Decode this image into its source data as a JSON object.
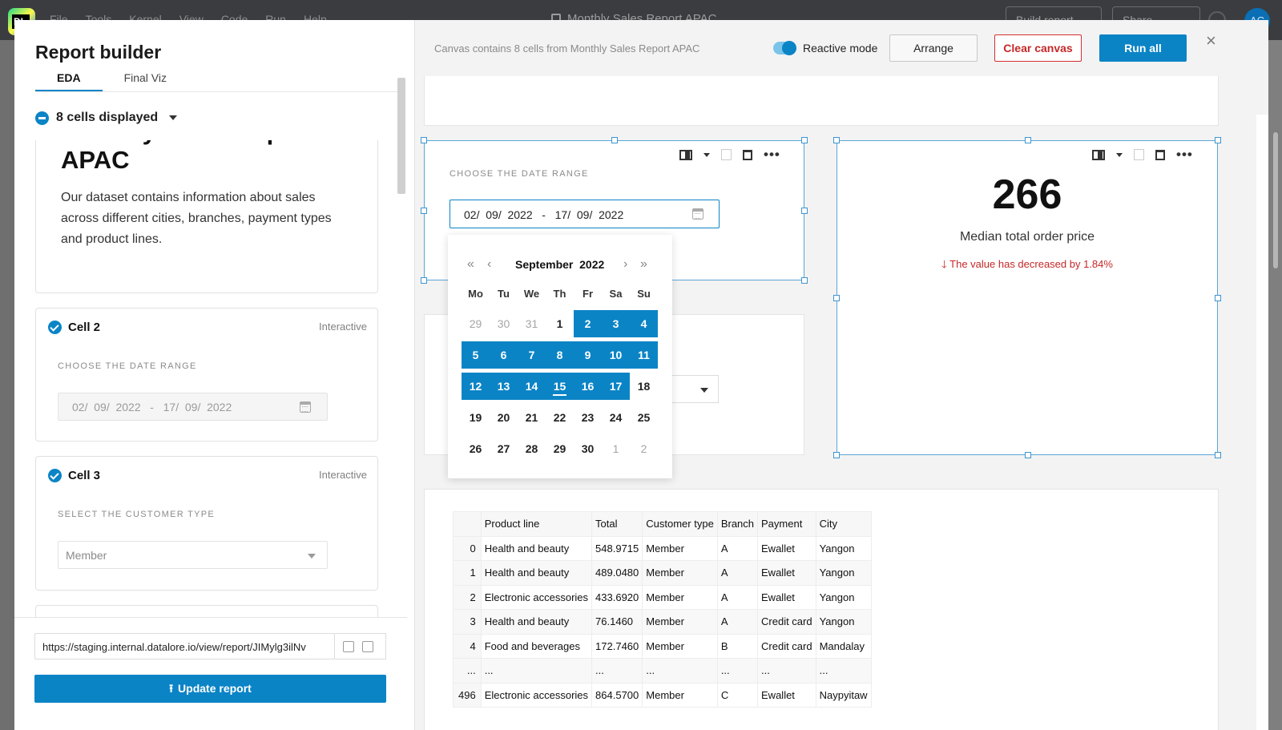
{
  "app": {
    "menu": [
      "File",
      "Tools",
      "Kernel",
      "View",
      "Code",
      "Run",
      "Help"
    ],
    "doc_title": "Monthly Sales Report APAC",
    "build_report": "Build report",
    "share": "Share",
    "avatar": "AC",
    "logo_text": "DL"
  },
  "panel": {
    "title": "Report builder",
    "tabs": [
      "EDA",
      "Final Viz"
    ],
    "cells_count": "8 cells displayed",
    "cell1": {
      "heading": "Monthly Sales Report APAC",
      "description": "Our dataset contains information about sales across different cities, branches, payment types and product lines."
    },
    "cell2": {
      "title": "Cell 2",
      "tag": "Interactive",
      "label": "CHOOSE THE DATE RANGE",
      "value": "02/  09/  2022   -   17/  09/  2022"
    },
    "cell3": {
      "title": "Cell 3",
      "tag": "Interactive",
      "label": "SELECT THE CUSTOMER TYPE",
      "value": "Member"
    },
    "url": "https://staging.internal.datalore.io/view/report/JIMylg3ilNv",
    "update_button": "Update report"
  },
  "canvas": {
    "info": "Canvas contains 8 cells from Monthly Sales Report APAC",
    "reactive_label": "Reactive mode",
    "reactive_on": true,
    "arrange": "Arrange",
    "clear": "Clear canvas",
    "run_all": "Run all",
    "close": "×"
  },
  "date_cell": {
    "label": "CHOOSE THE DATE RANGE",
    "value": "02/  09/  2022   -   17/  09/  2022"
  },
  "calendar": {
    "month": "September",
    "year": "2022",
    "prev_year": "«",
    "prev_month": "‹",
    "next_month": "›",
    "next_year": "»",
    "weekdays": [
      "Mo",
      "Tu",
      "We",
      "Th",
      "Fr",
      "Sa",
      "Su"
    ],
    "days": [
      [
        "29",
        "30",
        "31",
        "1",
        "2",
        "3",
        "4"
      ],
      [
        "5",
        "6",
        "7",
        "8",
        "9",
        "10",
        "11"
      ],
      [
        "12",
        "13",
        "14",
        "15",
        "16",
        "17",
        "18"
      ],
      [
        "19",
        "20",
        "21",
        "22",
        "23",
        "24",
        "25"
      ],
      [
        "26",
        "27",
        "28",
        "29",
        "30",
        "1",
        "2"
      ]
    ],
    "range_start": "2",
    "range_end": "17",
    "today": "15"
  },
  "metric": {
    "value": "266",
    "label": "Median total order price",
    "delta": "The value has decreased by 1.84%",
    "delta_color": "#c62828"
  },
  "table": {
    "headers": [
      "",
      "Product line",
      "Total",
      "Customer type",
      "Branch",
      "Payment",
      "City"
    ],
    "rows": [
      [
        "0",
        "Health and beauty",
        "548.9715",
        "Member",
        "A",
        "Ewallet",
        "Yangon"
      ],
      [
        "1",
        "Health and beauty",
        "489.0480",
        "Member",
        "A",
        "Ewallet",
        "Yangon"
      ],
      [
        "2",
        "Electronic accessories",
        "433.6920",
        "Member",
        "A",
        "Ewallet",
        "Yangon"
      ],
      [
        "3",
        "Health and beauty",
        "76.1460",
        "Member",
        "A",
        "Credit card",
        "Yangon"
      ],
      [
        "4",
        "Food and beverages",
        "172.7460",
        "Member",
        "B",
        "Credit card",
        "Mandalay"
      ],
      [
        "...",
        "...",
        "...",
        "...",
        "...",
        "...",
        "..."
      ],
      [
        "496",
        "Electronic accessories",
        "864.5700",
        "Member",
        "C",
        "Ewallet",
        "Naypyitaw"
      ]
    ]
  },
  "colors": {
    "accent": "#0b84c6",
    "danger": "#c62828"
  }
}
